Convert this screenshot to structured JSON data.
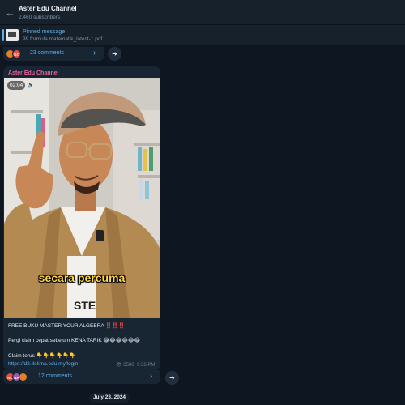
{
  "header": {
    "title": "Aster Edu Channel",
    "subscribers": "2,460 subscribers"
  },
  "pinned": {
    "label": "Pinned message",
    "text": "99 formula matematik_latest-1.pdf"
  },
  "top_comments": {
    "label": "23 comments",
    "avatars": [
      {
        "initials": "",
        "color": "#e67e22"
      },
      {
        "initials": "KC",
        "color": "#e74c3c"
      }
    ]
  },
  "post": {
    "sender": "Aster Edu Channel",
    "video": {
      "duration": "02:04",
      "caption": "secara percuma"
    },
    "lines": [
      "FREE BUKU MASTER YOUR ALGEBRA ‼️‼️‼️",
      "Pergi claim cepat sebelum KENA TARIK 😂😂😂😂😂😂",
      "Claim terus 👇👇👇👇👇👇"
    ],
    "link": "https://d2.delima.edu.my/login",
    "views": "6580",
    "time": "9:36 PM",
    "comments": {
      "label": "12 comments",
      "avatars": [
        {
          "initials": "NC",
          "color": "#e74c3c"
        },
        {
          "initials": "NA",
          "color": "#9b59b6"
        },
        {
          "initials": "",
          "color": "#e67e22"
        }
      ]
    }
  },
  "date_separator": "July 23, 2024"
}
